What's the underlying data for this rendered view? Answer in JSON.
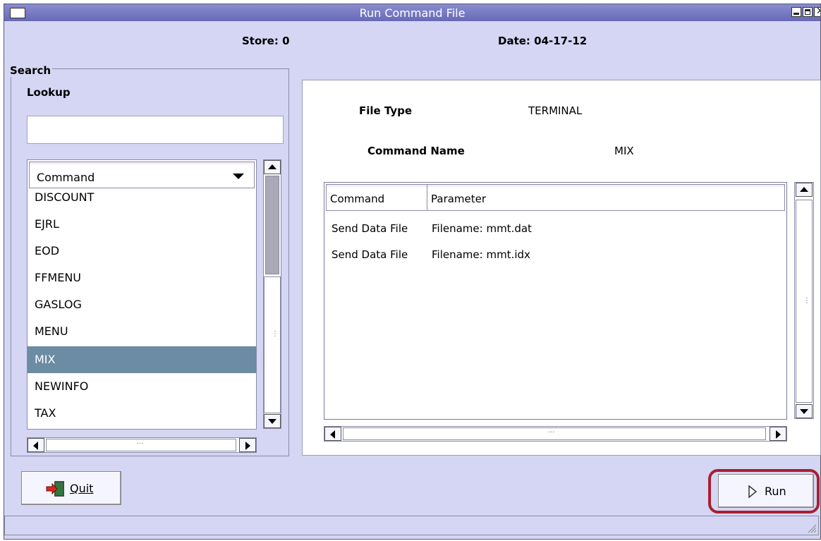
{
  "window": {
    "title": "Run Command File"
  },
  "header": {
    "store": "Store: 0",
    "date": "Date: 04-17-12"
  },
  "search": {
    "group_label": "Search",
    "lookup_label": "Lookup",
    "lookup_value": "",
    "list_header": "Command",
    "items": [
      {
        "label": "DISCOUNT",
        "selected": false
      },
      {
        "label": "EJRL",
        "selected": false
      },
      {
        "label": "EOD",
        "selected": false
      },
      {
        "label": "FFMENU",
        "selected": false
      },
      {
        "label": "GASLOG",
        "selected": false
      },
      {
        "label": "MENU",
        "selected": false
      },
      {
        "label": "MIX",
        "selected": true
      },
      {
        "label": "NEWINFO",
        "selected": false
      },
      {
        "label": "TAX",
        "selected": false
      }
    ]
  },
  "details": {
    "file_type_label": "File Type",
    "file_type_value": "TERMINAL",
    "command_name_label": "Command Name",
    "command_name_value": "MIX",
    "table": {
      "columns": [
        "Command",
        "Parameter"
      ],
      "rows": [
        [
          "Send Data File",
          "Filename: mmt.dat"
        ],
        [
          "Send Data File",
          "Filename: mmt.idx"
        ]
      ]
    }
  },
  "buttons": {
    "quit": "Quit",
    "run": "Run"
  },
  "icons": {
    "quit": "exit-door-icon",
    "run": "play-triangle-icon"
  },
  "colors": {
    "window_bg": "#d5d6f3",
    "title_bar": "#6769b6",
    "selection": "#6b8ca3",
    "highlight_ring": "#a82030"
  }
}
